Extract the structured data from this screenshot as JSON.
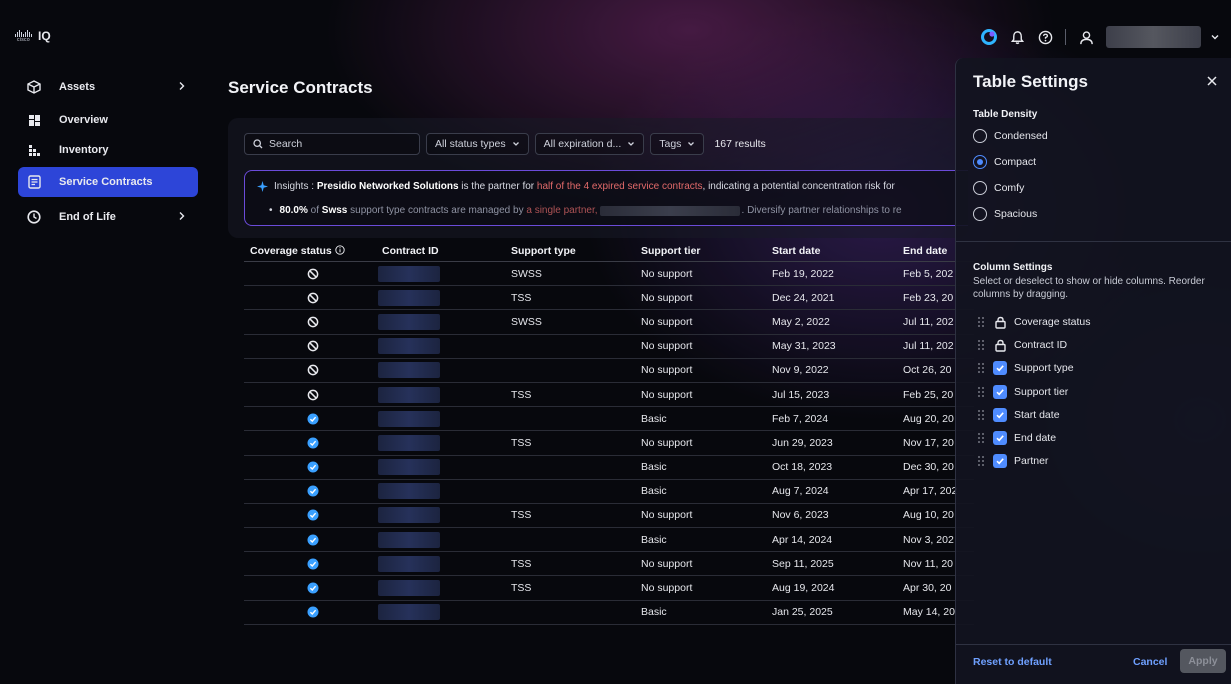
{
  "app": {
    "brand_small": "cisco",
    "name": "IQ"
  },
  "sidebar": {
    "items": [
      {
        "label": "Assets",
        "icon": "box-icon",
        "chevron": true
      },
      {
        "label": "Overview",
        "icon": "dashboard-icon"
      },
      {
        "label": "Inventory",
        "icon": "inventory-icon"
      },
      {
        "label": "Service Contracts",
        "icon": "contract-icon",
        "active": true
      },
      {
        "label": "End of Life",
        "icon": "clock-icon",
        "chevron": true
      }
    ]
  },
  "page": {
    "title": "Service Contracts"
  },
  "filters": {
    "search_placeholder": "Search",
    "status": "All status types",
    "expiration": "All expiration d...",
    "tags": "Tags",
    "results": "167 results"
  },
  "insights": {
    "prefix": "Insights :",
    "partner": "Presidio Networked Solutions",
    "text1": "is the partner for",
    "highlight1": "half of the 4 expired service contracts",
    "text2": ", indicating a potential concentration risk for",
    "pct": "80.0%",
    "text3": "of",
    "swss": "Swss",
    "text4": "support type contracts are managed by",
    "highlight2": "a single partner,",
    "text5": ". Diversify partner relationships to re"
  },
  "table": {
    "headers": {
      "coverage": "Coverage status",
      "contract_id": "Contract ID",
      "support_type": "Support type",
      "support_tier": "Support tier",
      "start": "Start date",
      "end": "End date"
    },
    "rows": [
      {
        "covered": false,
        "support_type": "SWSS",
        "support_tier": "No support",
        "start": "Feb 19, 2022",
        "end": "Feb 5, 202"
      },
      {
        "covered": false,
        "support_type": "TSS",
        "support_tier": "No support",
        "start": "Dec 24, 2021",
        "end": "Feb 23, 20"
      },
      {
        "covered": false,
        "support_type": "SWSS",
        "support_tier": "No support",
        "start": "May 2, 2022",
        "end": "Jul 11, 202"
      },
      {
        "covered": false,
        "support_type": "",
        "support_tier": "No support",
        "start": "May 31, 2023",
        "end": "Jul 11, 202"
      },
      {
        "covered": false,
        "support_type": "",
        "support_tier": "No support",
        "start": "Nov 9, 2022",
        "end": "Oct 26, 20"
      },
      {
        "covered": false,
        "support_type": "TSS",
        "support_tier": "No support",
        "start": "Jul 15, 2023",
        "end": "Feb 25, 20"
      },
      {
        "covered": true,
        "support_type": "",
        "support_tier": "Basic",
        "start": "Feb 7, 2024",
        "end": "Aug 20, 20"
      },
      {
        "covered": true,
        "support_type": "TSS",
        "support_tier": "No support",
        "start": "Jun 29, 2023",
        "end": "Nov 17, 20"
      },
      {
        "covered": true,
        "support_type": "",
        "support_tier": "Basic",
        "start": "Oct 18, 2023",
        "end": "Dec 30, 20"
      },
      {
        "covered": true,
        "support_type": "",
        "support_tier": "Basic",
        "start": "Aug 7, 2024",
        "end": "Apr 17, 202"
      },
      {
        "covered": true,
        "support_type": "TSS",
        "support_tier": "No support",
        "start": "Nov 6, 2023",
        "end": "Aug 10, 20"
      },
      {
        "covered": true,
        "support_type": "",
        "support_tier": "Basic",
        "start": "Apr 14, 2024",
        "end": "Nov 3, 202"
      },
      {
        "covered": true,
        "support_type": "TSS",
        "support_tier": "No support",
        "start": "Sep 11, 2025",
        "end": "Nov 11, 20"
      },
      {
        "covered": true,
        "support_type": "TSS",
        "support_tier": "No support",
        "start": "Aug 19, 2024",
        "end": "Apr 30, 20"
      },
      {
        "covered": true,
        "support_type": "",
        "support_tier": "Basic",
        "start": "Jan 25, 2025",
        "end": "May 14, 20"
      }
    ]
  },
  "settings": {
    "title": "Table Settings",
    "density_title": "Table Density",
    "density_options": [
      "Condensed",
      "Compact",
      "Comfy",
      "Spacious"
    ],
    "density_selected": "Compact",
    "columns_title": "Column Settings",
    "columns_desc": "Select or deselect to show or hide columns. Reorder columns by dragging.",
    "columns": [
      {
        "label": "Coverage status",
        "locked": true
      },
      {
        "label": "Contract ID",
        "locked": true
      },
      {
        "label": "Support type",
        "checked": true
      },
      {
        "label": "Support tier",
        "checked": true
      },
      {
        "label": "Start date",
        "checked": true
      },
      {
        "label": "End date",
        "checked": true
      },
      {
        "label": "Partner",
        "checked": true
      }
    ],
    "reset": "Reset to default",
    "cancel": "Cancel",
    "apply": "Apply"
  },
  "colors": {
    "accent": "#2d45d8",
    "link": "#6fa0ff",
    "check": "#4f8cff",
    "insight_red": "#e26a6a"
  }
}
